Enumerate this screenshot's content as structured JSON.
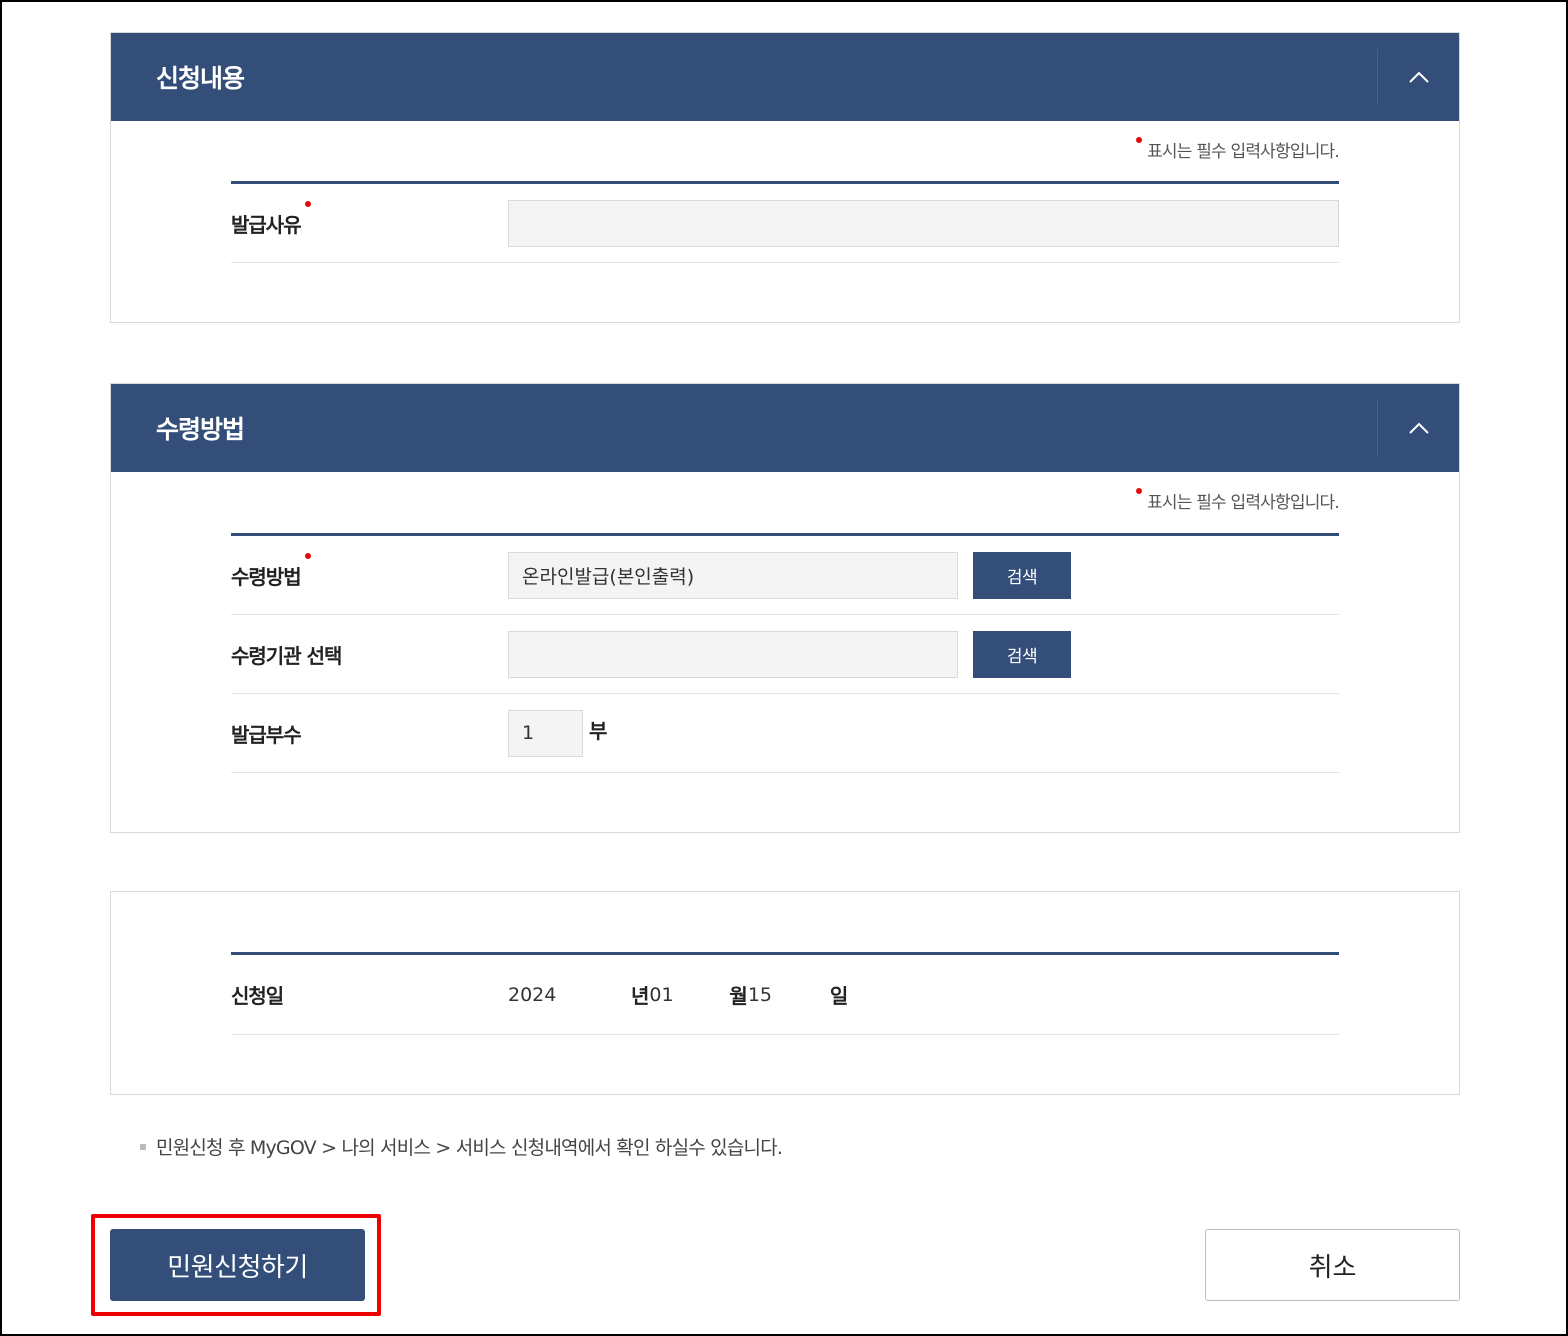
{
  "required_note": "표시는 필수 입력사항입니다.",
  "section1": {
    "title": "신청내용",
    "fields": {
      "reason_label": "발급사유",
      "reason_value": ""
    }
  },
  "section2": {
    "title": "수령방법",
    "fields": {
      "method_label": "수령방법",
      "method_value": "온라인발급(본인출력)",
      "agency_label": "수령기관 선택",
      "agency_value": "",
      "copies_label": "발급부수",
      "copies_value": "1",
      "copies_unit": "부",
      "search_label": "검색"
    }
  },
  "section3": {
    "date_label": "신청일",
    "year": "2024",
    "year_unit": "년",
    "month": "01",
    "month_unit": "월",
    "day": "15",
    "day_unit": "일"
  },
  "notice": "민원신청 후 MyGOV > 나의 서비스 > 서비스 신청내역에서 확인 하실수 있습니다.",
  "buttons": {
    "apply": "민원신청하기",
    "cancel": "취소"
  },
  "colors": {
    "primary": "#344e7a",
    "required": "#e30b0b",
    "highlight": "#ee0000"
  }
}
